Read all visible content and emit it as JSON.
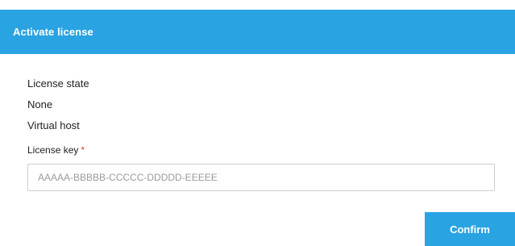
{
  "dialog": {
    "title": "Activate license",
    "accent_color": "#2aa3e2"
  },
  "info": {
    "license_state_label": "License state",
    "license_state_value": "None",
    "host_label": "Virtual host"
  },
  "license_key": {
    "label": "License key",
    "required_marker": "*",
    "placeholder": "AAAAA-BBBBB-CCCCC-DDDDD-EEEEE",
    "value": ""
  },
  "actions": {
    "confirm_label": "Confirm"
  }
}
